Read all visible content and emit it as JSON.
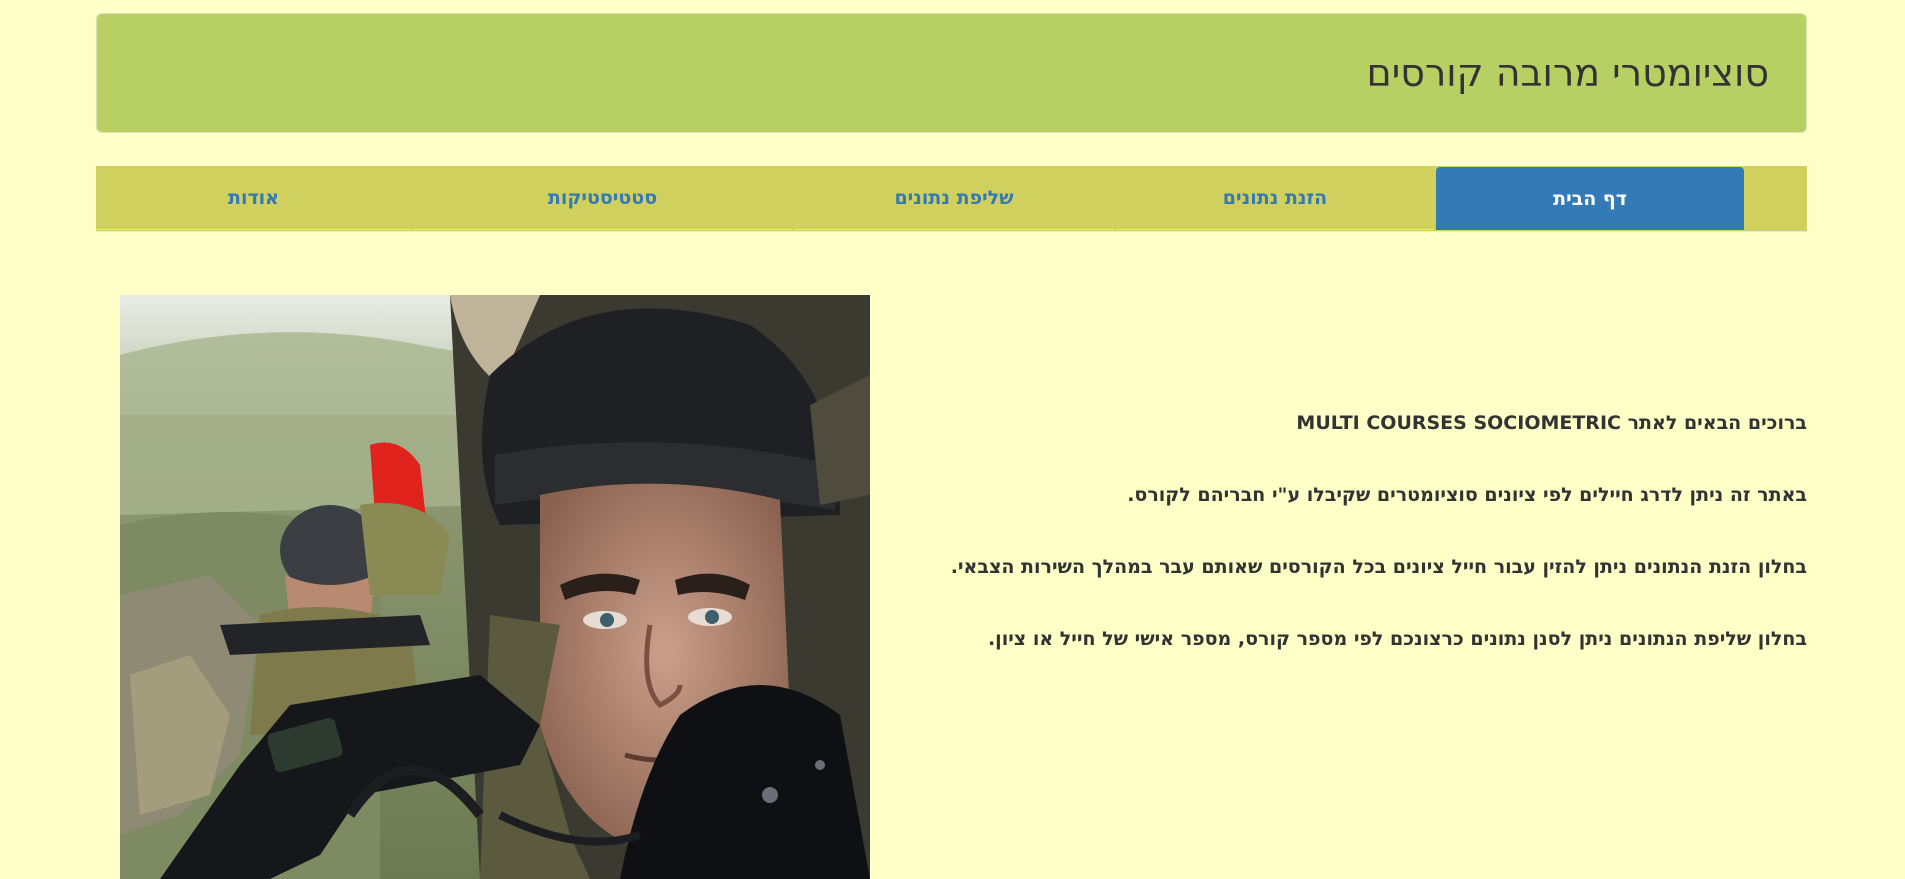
{
  "header": {
    "title": "סוציומטרי מרובה קורסים"
  },
  "nav": {
    "tabs": [
      {
        "label": "דף הבית",
        "active": true
      },
      {
        "label": "הזנת נתונים",
        "active": false
      },
      {
        "label": "שליפת נתונים",
        "active": false
      },
      {
        "label": "סטטיסטיקות",
        "active": false
      },
      {
        "label": "אודות",
        "active": false
      }
    ]
  },
  "main": {
    "paragraphs": [
      "ברוכים הבאים לאתר MULTI COURSES SOCIOMETRIC",
      "באתר זה ניתן לדרג חיילים לפי ציונים סוציומטרים שקיבלו ע\"י חבריהם לקורס.",
      "בחלון הזנת הנתונים ניתן להזין עבור חייל ציונים בכל הקורסים שאותם עבר במהלך השירות הצבאי.",
      "בחלון שליפת הנתונים ניתן לסנן נתונים כרצונכם לפי מספר קורס, מספר אישי של חייל או ציון."
    ]
  },
  "colors": {
    "page_background": "#ffffc8",
    "header_background": "#b8d063",
    "nav_background": "#cfd05e",
    "active_tab": "#337ab7",
    "link": "#337ab7"
  },
  "icons": {
    "hero_image": "soldier-photo"
  }
}
